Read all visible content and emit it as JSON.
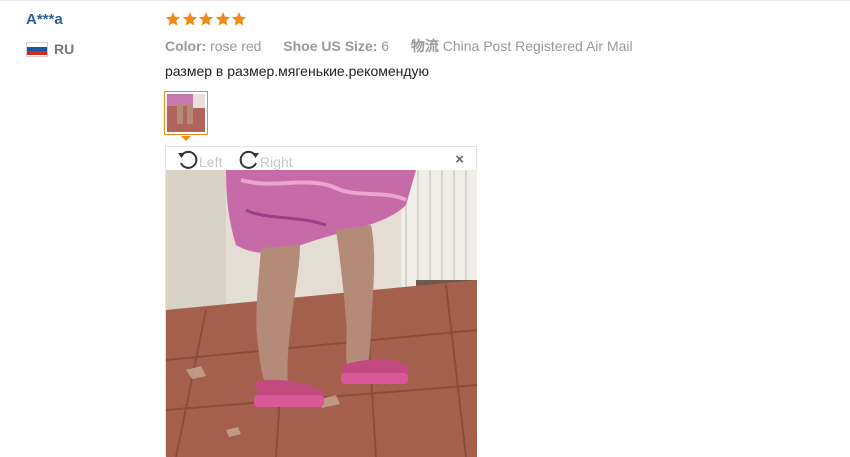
{
  "review": {
    "user": {
      "name": "A***a",
      "country_code": "RU",
      "flag_icon": "russia-flag-icon"
    },
    "rating": {
      "stars": 5,
      "max": 5,
      "color": "#f28a16"
    },
    "attributes": [
      {
        "label": "Color:",
        "value": "rose red"
      },
      {
        "label": "Shoe US Size:",
        "value": "6"
      },
      {
        "label": "物流",
        "value": "China Post Registered Air Mail"
      }
    ],
    "text": "размер в размер.мягенькие.рекомендую",
    "photo_viewer": {
      "rotate_left_label": "Left",
      "rotate_right_label": "Right",
      "close_label": "×"
    }
  },
  "colors": {
    "accent": "#f28a16",
    "username": "#2e5e9c",
    "meta_text": "#999999"
  }
}
